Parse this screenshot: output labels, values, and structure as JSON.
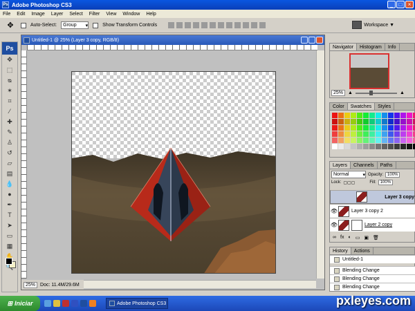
{
  "window": {
    "title": "Adobe Photoshop CS3",
    "app_icon": "Ps"
  },
  "menu": [
    "File",
    "Edit",
    "Image",
    "Layer",
    "Select",
    "Filter",
    "View",
    "Window",
    "Help"
  ],
  "options": {
    "auto_select_label": "Auto-Select:",
    "auto_select_value": "Group",
    "transform_label": "Show Transform Controls",
    "workspace_label": "Workspace ▼"
  },
  "toolbox": {
    "logo": "Ps"
  },
  "document": {
    "title": "Untitled-1 @ 25% (Layer 3 copy, RGB/8)",
    "zoom": "25%",
    "doc_info": "Doc: 11.4M/29.6M"
  },
  "navigator": {
    "tabs": [
      "Navigator",
      "Histogram",
      "Info"
    ],
    "zoom": "25%"
  },
  "color_panel": {
    "tabs": [
      "Color",
      "Swatches",
      "Styles"
    ]
  },
  "layers": {
    "tabs": [
      "Layers",
      "Channels",
      "Paths"
    ],
    "blend_mode": "Normal",
    "opacity_label": "Opacity:",
    "opacity": "100%",
    "lock_label": "Lock:",
    "fill_label": "Fill:",
    "fill": "100%",
    "items": [
      {
        "name": "Layer 3 copy"
      },
      {
        "name": "Layer 3 copy 2"
      },
      {
        "name": "Layer 2 copy"
      }
    ]
  },
  "history": {
    "tabs": [
      "History",
      "Actions"
    ],
    "items": [
      "Untitled-1",
      "Blending Change",
      "Blending Change",
      "Blending Change"
    ]
  },
  "taskbar": {
    "start_label": "Iniciar",
    "task": "Adobe Photoshop CS3"
  },
  "watermark": "pxleyes.com",
  "colors": {
    "accent": "#0a57e0",
    "start": "#2d8a2d",
    "pyramid_red": "#b82a1a",
    "ground": "#5a4b36"
  }
}
